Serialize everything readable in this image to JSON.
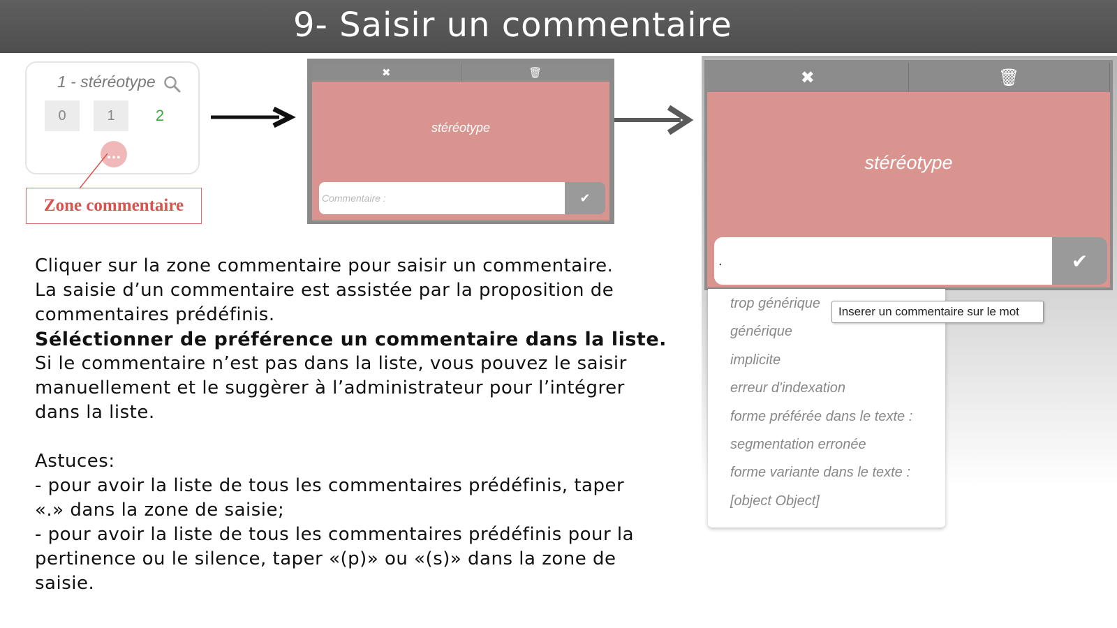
{
  "header": {
    "title": "9- Saisir un commentaire"
  },
  "card": {
    "term": "1 - stéréotype",
    "scores": [
      "0",
      "1",
      "2"
    ],
    "comment_button": "..."
  },
  "annotation": {
    "label": "Zone commentaire"
  },
  "panel_small": {
    "close_icon": "✖",
    "delete_icon": "🗑",
    "term": "stéréotype",
    "comment_placeholder": "Commentaire :",
    "validate_icon": "✔"
  },
  "panel_large": {
    "close_icon": "✖",
    "delete_icon": "🗑",
    "term": "stéréotype",
    "comment_value": ".",
    "validate_icon": "✔",
    "suggestions": [
      "trop générique",
      "générique",
      "implicite",
      "erreur d'indexation",
      "forme préférée dans le texte :",
      "segmentation erronée",
      "forme variante dans le texte :",
      "[object Object]"
    ],
    "tooltip": "Inserer un commentaire sur le mot"
  },
  "instructions": {
    "lines": [
      "Cliquer sur la zone commentaire pour saisir un commentaire.",
      "La saisie d’un commentaire est assistée par la proposition de",
      "commentaires prédéfinis."
    ],
    "bold": "Séléctionner de préférence un commentaire dans la liste.",
    "lines2": [
      "Si le commentaire n’est pas dans la liste, vous pouvez le saisir",
      "manuellement et le suggèrer à l’administrateur pour l’intégrer",
      "dans la liste."
    ],
    "tips_title": "Astuces:",
    "tips": [
      " - pour avoir la liste de tous les commentaires prédéfinis, taper",
      "«.» dans la zone de saisie;",
      " - pour avoir la liste de tous les commentaires prédéfinis pour la",
      "pertinence ou le silence, taper «(p)» ou «(s)» dans la zone de",
      "saisie."
    ]
  },
  "colors": {
    "header_bg": "#555555",
    "panel_pink": "#d99490",
    "toolbar_gray": "#8c8c8c",
    "annotation_red": "#d9534f",
    "score_green": "#3aa83a"
  }
}
